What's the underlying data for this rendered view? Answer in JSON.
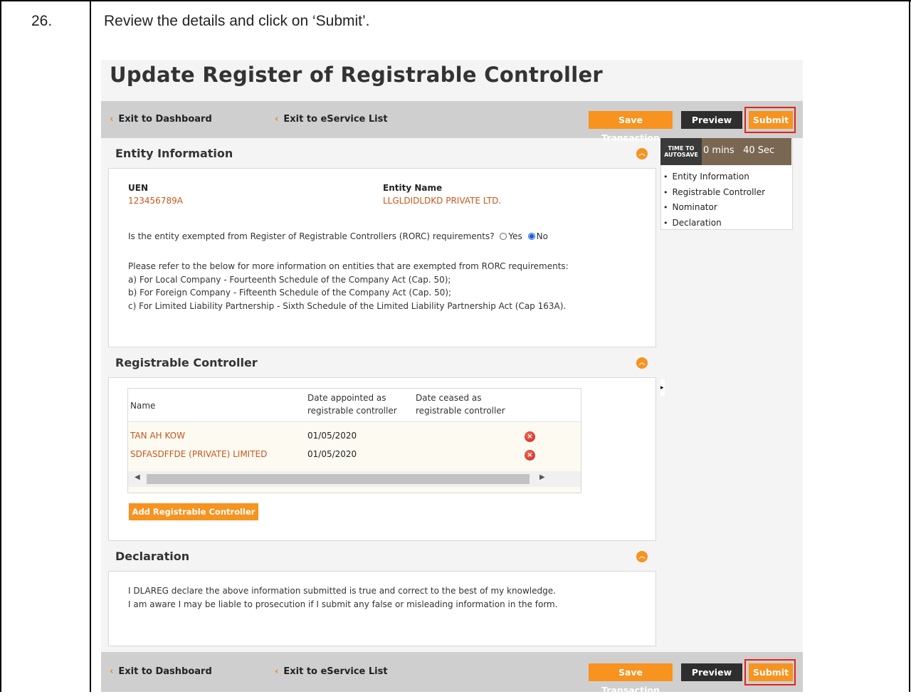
{
  "step": {
    "number": "26.",
    "instruction": "Review the details and click on ‘Submit’."
  },
  "page_title": "Update Register of Registrable Controller",
  "nav": {
    "exit_dashboard": "Exit to Dashboard",
    "exit_eservice": "Exit to eService List",
    "save": "Save Transaction",
    "preview": "Preview",
    "submit": "Submit"
  },
  "autosave": {
    "label_line1": "TIME TO",
    "label_line2": "AUTOSAVE",
    "value": "0 mins   40 Sec"
  },
  "toc": [
    "Entity Information",
    "Registrable Controller",
    "Nominator",
    "Declaration"
  ],
  "entity": {
    "heading": "Entity Information",
    "uen_label": "UEN",
    "uen_value": "123456789A",
    "name_label": "Entity Name",
    "name_value": "LLGLDIDLDKD PRIVATE LTD.",
    "exempt_question": "Is the entity exempted from Register of Registrable Controllers (RORC) requirements?",
    "opt_yes": "Yes",
    "opt_no": "No",
    "selected": "No",
    "info_lines": [
      "Please refer to the below for more information on entities that are exempted from RORC requirements:",
      "a) For Local Company - Fourteenth Schedule of the Company Act (Cap. 50);",
      "b) For Foreign Company - Fifteenth Schedule of the Company Act (Cap. 50);",
      "c) For Limited Liability Partnership - Sixth Schedule of the Limited Liability Partnership Act (Cap 163A)."
    ]
  },
  "controllers": {
    "heading": "Registrable Controller",
    "columns": [
      "Name",
      "Date appointed as registrable controller",
      "Date ceased as registrable controller"
    ],
    "col_name": "Name",
    "col_appointed_1": "Date appointed as",
    "col_appointed_2": "registrable controller",
    "col_ceased_1": "Date ceased as",
    "col_ceased_2": "registrable controller",
    "rows": [
      {
        "name": "TAN AH KOW",
        "appointed": "01/05/2020",
        "ceased": ""
      },
      {
        "name": "SDFASDFFDE (PRIVATE) LIMITED",
        "appointed": "01/05/2020",
        "ceased": ""
      }
    ],
    "add_button": "Add Registrable Controller"
  },
  "declaration": {
    "heading": "Declaration",
    "line1": "I DLAREG declare the above information submitted is true and correct to the best of my knowledge.",
    "line2": "I am aware I may be liable to prosecution if I submit any false or misleading information in the form."
  },
  "colors": {
    "accent": "#f7931e",
    "highlight": "#e1251b",
    "link_text": "#c8571a",
    "navbar": "#cfcfcf"
  }
}
